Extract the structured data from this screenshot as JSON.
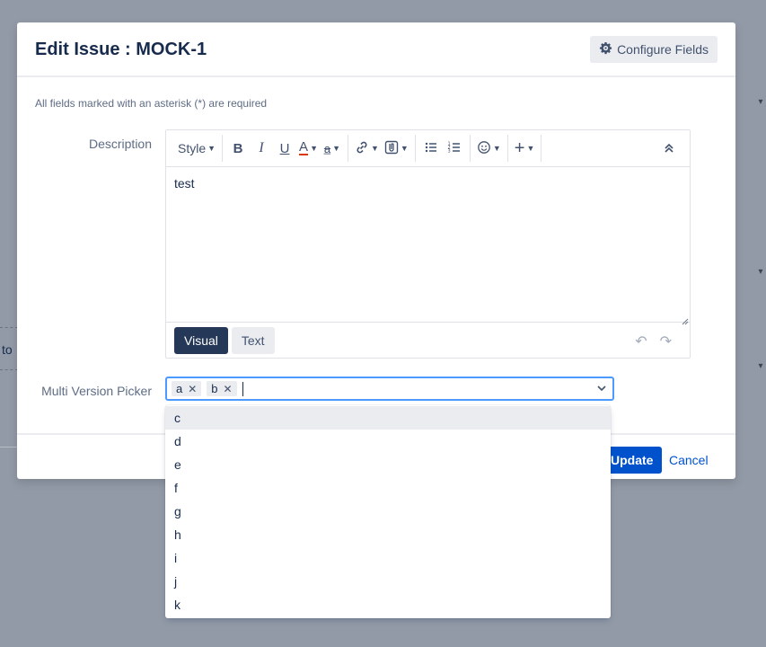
{
  "background": {
    "partial_text": "to"
  },
  "modal": {
    "title": "Edit Issue : MOCK-1",
    "configure_fields_label": "Configure Fields",
    "required_note": "All fields marked with an asterisk (*) are required"
  },
  "description": {
    "label": "Description",
    "toolbar": {
      "style_label": "Style"
    },
    "content": "test",
    "mode_visual": "Visual",
    "mode_text": "Text"
  },
  "multi_version_picker": {
    "label": "Multi Version Picker",
    "selected": [
      "a",
      "b"
    ],
    "options": [
      "c",
      "d",
      "e",
      "f",
      "g",
      "h",
      "i",
      "j",
      "k"
    ],
    "highlighted_option": "c"
  },
  "footer": {
    "update_label": "Update",
    "cancel_label": "Cancel"
  },
  "colors": {
    "primary": "#0052cc",
    "focus_border": "#4c9aff",
    "overlay": "#929aa7",
    "text_color_underline": "#de350b"
  }
}
